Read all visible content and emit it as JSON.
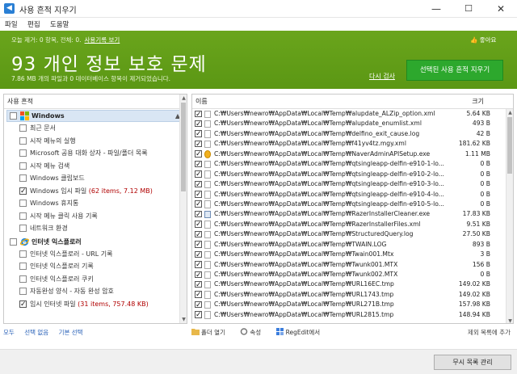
{
  "window": {
    "title": "사용 흔적 지우기",
    "min": "—",
    "max": "☐",
    "close": "✕"
  },
  "menu": [
    "파일",
    "편집",
    "도움말"
  ],
  "banner": {
    "stats": "오늘 제거: 0 항목, 전체: 0.",
    "history_link": "사용기록 보기",
    "big_title": "93 개인 정보 보호 문제",
    "subtitle": "7.86 MB 개의 파일과 0 데이터베이스 항목이 제거되었습니다.",
    "like": "좋아요",
    "rescan": "다시 검사",
    "clean_button": "선택된 사용 흔적 지우기",
    "colors": {
      "banner_bg": "#63a01a",
      "clean_button": "#2da82d"
    }
  },
  "left_pane": {
    "header": "사용 흔적",
    "categories": [
      {
        "label": "Windows",
        "icon": "windows-logo-icon",
        "checked": false,
        "arrow": "▲",
        "items": [
          {
            "label": "최근 문서",
            "checked": false
          },
          {
            "label": "시작 메뉴의 실행",
            "checked": false
          },
          {
            "label": "Microsoft 공용 대화 상자 - 파일/폴더 목록",
            "checked": false
          },
          {
            "label": "시작 메뉴 검색",
            "checked": false
          },
          {
            "label": "Windows 클립보드",
            "checked": false
          },
          {
            "label": "Windows 임시 파일",
            "checked": true,
            "value": "(62 items, 7.12 MB)"
          },
          {
            "label": "Windows 휴지통",
            "checked": false
          },
          {
            "label": "시작 메뉴 클릭 사용 기록",
            "checked": false
          },
          {
            "label": "네트워크 환경",
            "checked": false
          }
        ]
      },
      {
        "label": "인터넷 익스플로러",
        "icon": "internet-explorer-icon",
        "checked": false,
        "arrow": "",
        "items": [
          {
            "label": "인터넷 익스플로러 - URL 기록",
            "checked": false
          },
          {
            "label": "인터넷 익스플로러 기록",
            "checked": false
          },
          {
            "label": "인터넷 익스플로러 쿠키",
            "checked": false
          },
          {
            "label": "자동완성 양식 - 자동 완성 암호",
            "checked": false
          },
          {
            "label": "임시 인터넷 파일",
            "checked": true,
            "value": "(31 items, 757.48 KB)"
          }
        ]
      }
    ]
  },
  "right_pane": {
    "col_name": "이름",
    "col_size": "크기",
    "files": [
      {
        "path": "C:₩Users₩newro₩AppData₩Local₩Temp₩alupdate_ALZip_option.xml",
        "size": "5.64 KB",
        "icon": "doc"
      },
      {
        "path": "C:₩Users₩newro₩AppData₩Local₩Temp₩alupdate_enumlist.xml",
        "size": "493 B",
        "icon": "doc"
      },
      {
        "path": "C:₩Users₩newro₩AppData₩Local₩Temp₩delfino_exit_cause.log",
        "size": "42 B",
        "icon": "doc"
      },
      {
        "path": "C:₩Users₩newro₩AppData₩Local₩Temp₩f41yv4tz.mgy.xml",
        "size": "181.62 KB",
        "icon": "doc"
      },
      {
        "path": "C:₩Users₩newro₩AppData₩Local₩Temp₩NaverAdminAPISetup.exe",
        "size": "1.11 MB",
        "icon": "naver"
      },
      {
        "path": "C:₩Users₩newro₩AppData₩Local₩Temp₩qtsingleapp-delfin-e910-1-lo...",
        "size": "0 B",
        "icon": "doc"
      },
      {
        "path": "C:₩Users₩newro₩AppData₩Local₩Temp₩qtsingleapp-delfin-e910-2-lo...",
        "size": "0 B",
        "icon": "doc"
      },
      {
        "path": "C:₩Users₩newro₩AppData₩Local₩Temp₩qtsingleapp-delfin-e910-3-lo...",
        "size": "0 B",
        "icon": "doc"
      },
      {
        "path": "C:₩Users₩newro₩AppData₩Local₩Temp₩qtsingleapp-delfin-e910-4-lo...",
        "size": "0 B",
        "icon": "doc"
      },
      {
        "path": "C:₩Users₩newro₩AppData₩Local₩Temp₩qtsingleapp-delfin-e910-5-lo...",
        "size": "0 B",
        "icon": "doc"
      },
      {
        "path": "C:₩Users₩newro₩AppData₩Local₩Temp₩RazerInstallerCleaner.exe",
        "size": "17.83 KB",
        "icon": "exe"
      },
      {
        "path": "C:₩Users₩newro₩AppData₩Local₩Temp₩RazerInstallerFiles.xml",
        "size": "9.51 KB",
        "icon": "doc"
      },
      {
        "path": "C:₩Users₩newro₩AppData₩Local₩Temp₩StructuredQuery.log",
        "size": "27.50 KB",
        "icon": "doc"
      },
      {
        "path": "C:₩Users₩newro₩AppData₩Local₩Temp₩TWAIN.LOG",
        "size": "893 B",
        "icon": "doc"
      },
      {
        "path": "C:₩Users₩newro₩AppData₩Local₩Temp₩Twain001.Mtx",
        "size": "3 B",
        "icon": "doc"
      },
      {
        "path": "C:₩Users₩newro₩AppData₩Local₩Temp₩Twunk001.MTX",
        "size": "156 B",
        "icon": "doc"
      },
      {
        "path": "C:₩Users₩newro₩AppData₩Local₩Temp₩Twunk002.MTX",
        "size": "0 B",
        "icon": "doc"
      },
      {
        "path": "C:₩Users₩newro₩AppData₩Local₩Temp₩URL16EC.tmp",
        "size": "149.02 KB",
        "icon": "doc"
      },
      {
        "path": "C:₩Users₩newro₩AppData₩Local₩Temp₩URL1743.tmp",
        "size": "149.02 KB",
        "icon": "doc"
      },
      {
        "path": "C:₩Users₩newro₩AppData₩Local₩Temp₩URL271B.tmp",
        "size": "157.98 KB",
        "icon": "doc"
      },
      {
        "path": "C:₩Users₩newro₩AppData₩Local₩Temp₩URL2815.tmp",
        "size": "148.94 KB",
        "icon": "doc"
      }
    ]
  },
  "bottom": {
    "select_all": "모두",
    "select_none": "선택 없음",
    "select_default": "기본 선택",
    "open_folder": "폴더 열기",
    "properties": "속성",
    "regedit": "RegEdit에서",
    "exclude": "제외 목록에 추가",
    "ignore_list_button": "무시 목록 관리"
  }
}
